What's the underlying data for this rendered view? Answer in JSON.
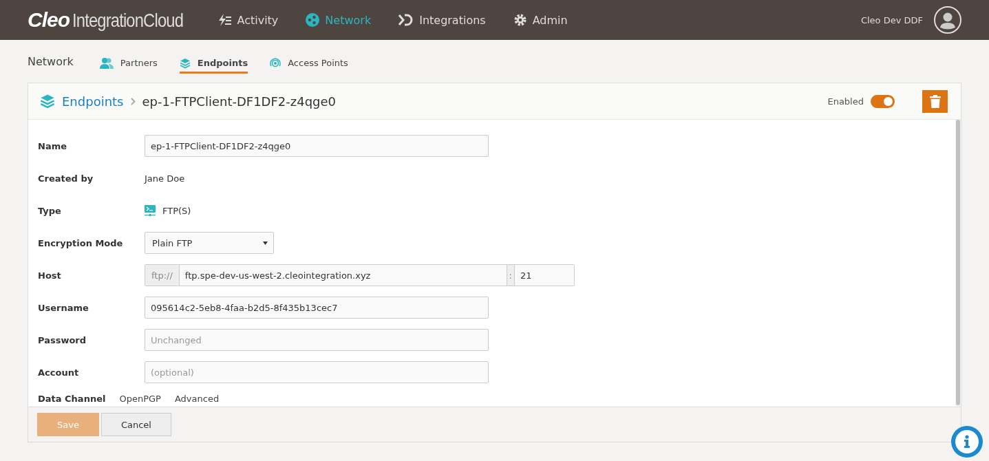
{
  "topbar": {
    "logo_bold": "Cleo",
    "logo_rest": "IntegrationCloud",
    "nav": [
      {
        "label": "Activity",
        "kind": "activity",
        "selected": false
      },
      {
        "label": "Network",
        "kind": "network",
        "selected": true
      },
      {
        "label": "Integrations",
        "kind": "integrations",
        "selected": false
      },
      {
        "label": "Admin",
        "kind": "admin",
        "selected": false
      }
    ],
    "user": "Cleo Dev DDF"
  },
  "subnav": {
    "title": "Network",
    "tabs": [
      {
        "label": "Partners",
        "kind": "partners",
        "selected": false
      },
      {
        "label": "Endpoints",
        "kind": "endpoints",
        "selected": true
      },
      {
        "label": "Access Points",
        "kind": "access",
        "selected": false
      }
    ]
  },
  "panel": {
    "breadcrumb": {
      "parent": "Endpoints",
      "current": "ep-1-FTPClient-DF1DF2-z4qge0"
    },
    "enabled": {
      "label": "Enabled",
      "on": true
    },
    "fields": [
      {
        "kind": "input",
        "label": "Name",
        "value": "ep-1-FTPClient-DF1DF2-z4qge0"
      },
      {
        "kind": "text",
        "label": "Created by",
        "value": "Jane Doe"
      },
      {
        "kind": "type",
        "label": "Type",
        "value": "FTP(S)"
      },
      {
        "kind": "select",
        "label": "Encryption Mode",
        "value": "Plain FTP"
      },
      {
        "kind": "host",
        "label": "Host",
        "prefix": "ftp://",
        "value": "ftp.spe-dev-us-west-2.cleointegration.xyz",
        "separator": ":",
        "port": "21"
      },
      {
        "kind": "input",
        "label": "Username",
        "value": "095614c2-5eb8-4faa-b2d5-8f435b13cec7"
      },
      {
        "kind": "input",
        "label": "Password",
        "placeholder": "Unchanged"
      },
      {
        "kind": "input",
        "label": "Account",
        "placeholder": "(optional)"
      }
    ],
    "section_tabs": [
      "Data Channel",
      "OpenPGP",
      "Advanced"
    ],
    "buttons": [
      {
        "label": "Save",
        "kind": "primary"
      },
      {
        "label": "Cancel",
        "kind": "secondary"
      }
    ]
  }
}
